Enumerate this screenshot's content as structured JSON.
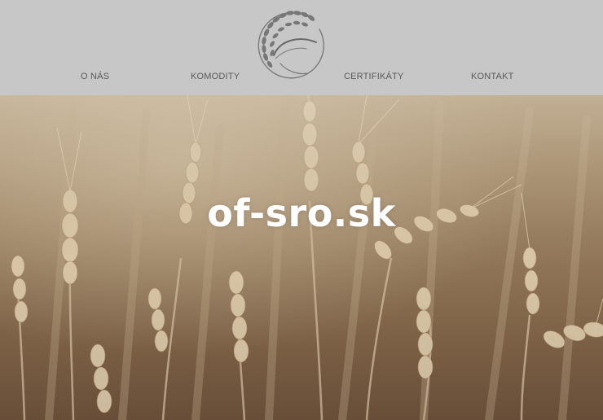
{
  "nav": {
    "items": [
      {
        "label": "O NÁS"
      },
      {
        "label": "KOMODITY"
      },
      {
        "label": "CERTIFIKÁTY"
      },
      {
        "label": "KONTAKT"
      }
    ]
  },
  "logo": {
    "icon": "wheat-wreath-logo-icon"
  },
  "hero": {
    "title": "of-sro.sk",
    "background": "wheat-field-photo"
  },
  "colors": {
    "header_bg": "#c7c7c7",
    "nav_text": "#5a5a5a",
    "hero_text": "#ffffff"
  }
}
